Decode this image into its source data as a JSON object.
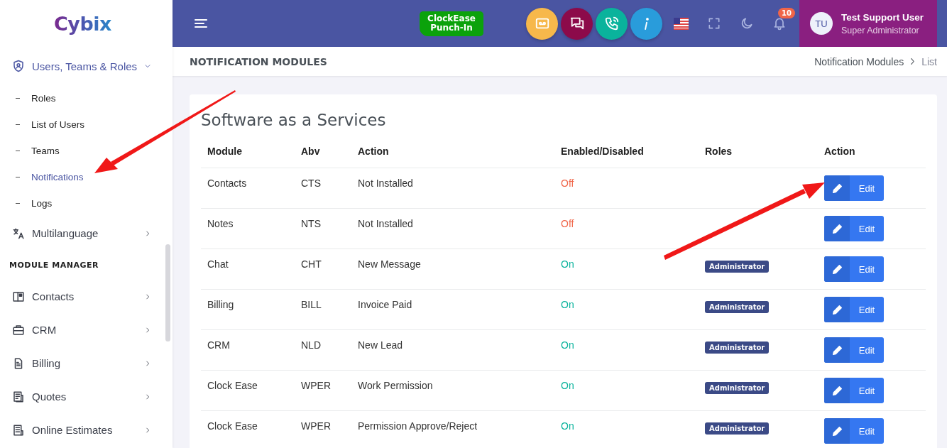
{
  "logo": {
    "text": "Cybix"
  },
  "header": {
    "punch_in": "ClockEase Punch-In",
    "notification_count": "10",
    "user": {
      "initials": "TU",
      "name": "Test Support User",
      "role": "Super Administrator"
    }
  },
  "sidebar": {
    "items": [
      {
        "kind": "group",
        "label": "Users, Teams & Roles",
        "expanded": true,
        "children": [
          {
            "label": "Roles",
            "selected": false
          },
          {
            "label": "List of Users",
            "selected": false
          },
          {
            "label": "Teams",
            "selected": false
          },
          {
            "label": "Notifications",
            "selected": true
          },
          {
            "label": "Logs",
            "selected": false
          }
        ]
      },
      {
        "kind": "group",
        "label": "Multilanguage",
        "expanded": false
      },
      {
        "kind": "section",
        "label": "MODULE MANAGER"
      },
      {
        "kind": "group",
        "label": "Contacts",
        "expanded": false
      },
      {
        "kind": "group",
        "label": "CRM",
        "expanded": false
      },
      {
        "kind": "group",
        "label": "Billing",
        "expanded": false
      },
      {
        "kind": "group",
        "label": "Quotes",
        "expanded": false
      },
      {
        "kind": "group",
        "label": "Online Estimates",
        "expanded": false
      }
    ]
  },
  "page": {
    "title": "NOTIFICATION MODULES",
    "breadcrumb": [
      "Notification Modules",
      "List"
    ]
  },
  "card": {
    "title": "Software as a Services",
    "table": {
      "columns": [
        "Module",
        "Abv",
        "Action",
        "Enabled/Disabled",
        "Roles",
        "Action"
      ],
      "rows": [
        {
          "module": "Contacts",
          "abv": "CTS",
          "action": "Not Installed",
          "status": "Off",
          "enabled": false,
          "roles": [],
          "button": "Edit"
        },
        {
          "module": "Notes",
          "abv": "NTS",
          "action": "Not Installed",
          "status": "Off",
          "enabled": false,
          "roles": [],
          "button": "Edit"
        },
        {
          "module": "Chat",
          "abv": "CHT",
          "action": "New Message",
          "status": "On",
          "enabled": true,
          "roles": [
            "Administrator"
          ],
          "button": "Edit"
        },
        {
          "module": "Billing",
          "abv": "BILL",
          "action": "Invoice Paid",
          "status": "On",
          "enabled": true,
          "roles": [
            "Administrator"
          ],
          "button": "Edit"
        },
        {
          "module": "CRM",
          "abv": "NLD",
          "action": "New Lead",
          "status": "On",
          "enabled": true,
          "roles": [
            "Administrator"
          ],
          "button": "Edit"
        },
        {
          "module": "Clock Ease",
          "abv": "WPER",
          "action": "Work Permission",
          "status": "On",
          "enabled": true,
          "roles": [
            "Administrator"
          ],
          "button": "Edit"
        },
        {
          "module": "Clock Ease",
          "abv": "WPER",
          "action": "Permission Approve/Reject",
          "status": "On",
          "enabled": true,
          "roles": [
            "Administrator"
          ],
          "button": "Edit"
        }
      ]
    }
  }
}
